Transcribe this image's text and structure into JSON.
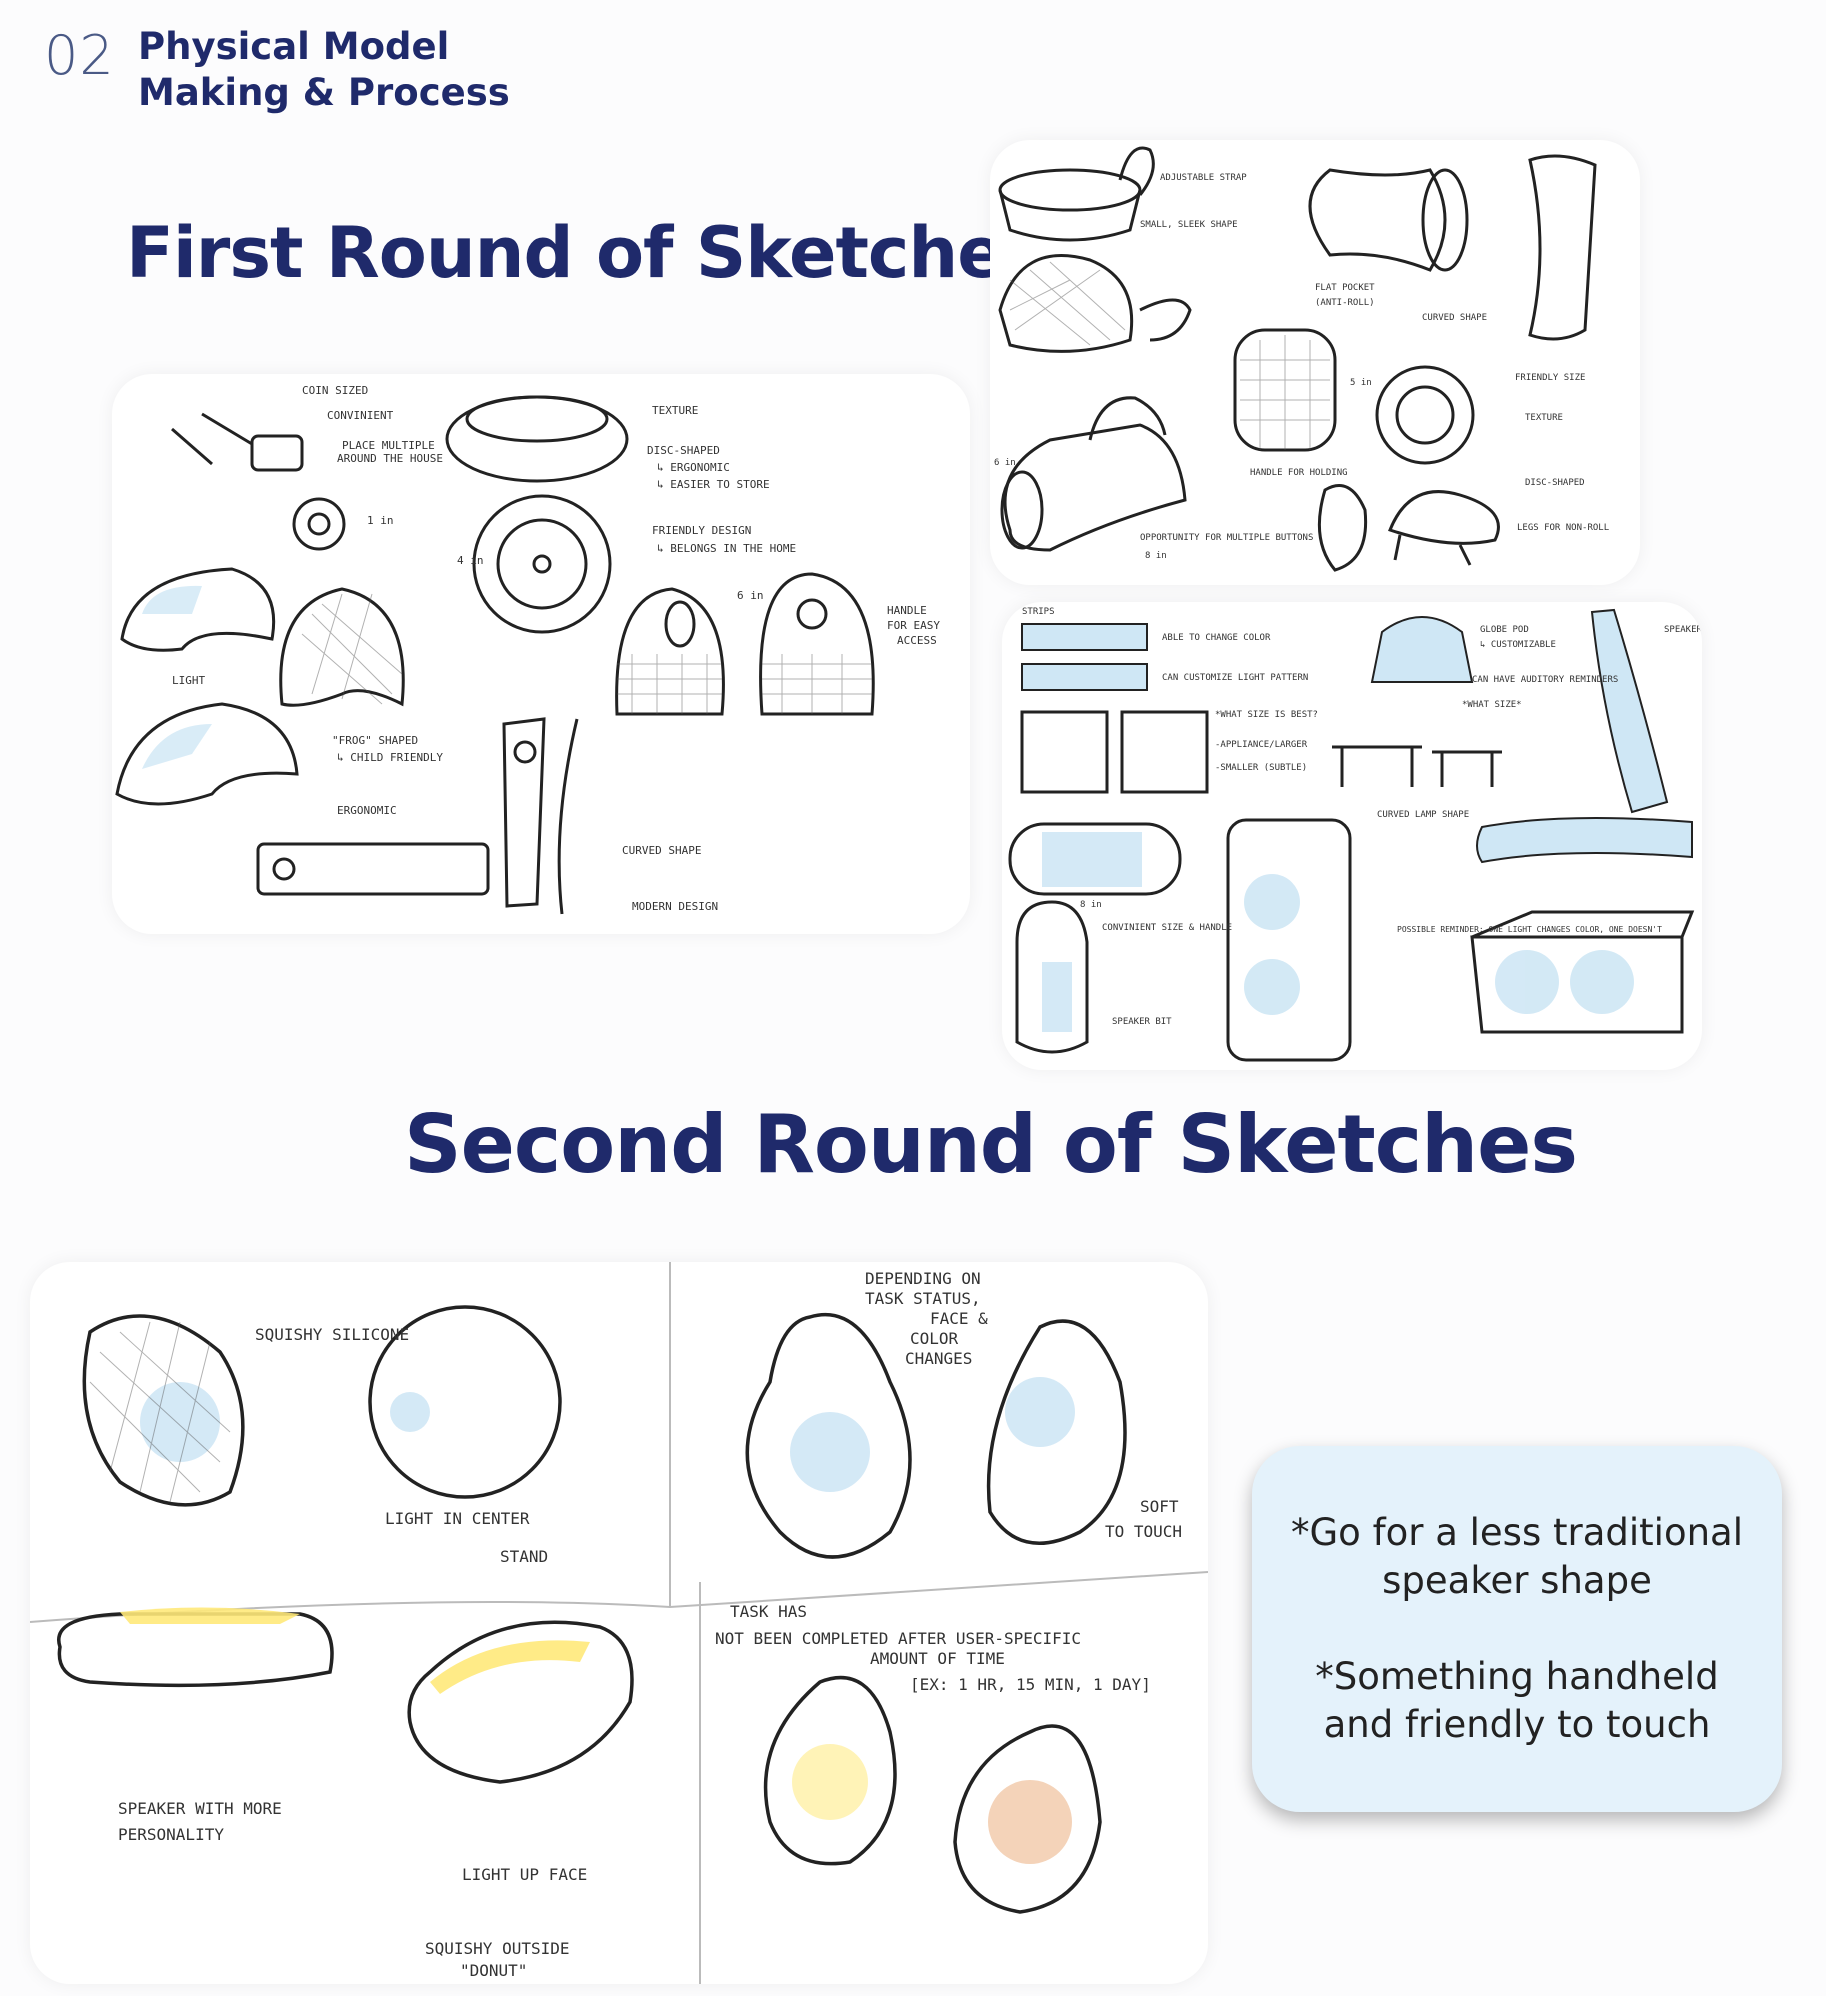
{
  "header": {
    "number": "02",
    "title_line1": "Physical Model",
    "title_line2": "Making & Process"
  },
  "headings": {
    "first_round": "First Round of Sketches",
    "second_round": "Second Round of Sketches"
  },
  "sketch_a": {
    "coin_sized": "COIN SIZED",
    "convinient": "CONVINIENT",
    "place_multiple": "PLACE MULTIPLE",
    "around_house": "AROUND THE HOUSE",
    "texture": "TEXTURE",
    "disc_shaped": "DISC-SHAPED",
    "ergonomic": "↳ ERGONOMIC",
    "easier_store": "↳ EASIER TO STORE",
    "friendly_design": "FRIENDLY DESIGN",
    "belongs_home": "↳ BELONGS IN THE HOME",
    "one_in": "1 in",
    "four_in": "4 in",
    "six_in": "6 in",
    "handle": "HANDLE",
    "for_easy": "FOR EASY",
    "access": "ACCESS",
    "light": "LIGHT",
    "frog_shaped": "\"FROG\" SHAPED",
    "child_friendly": "↳ CHILD FRIENDLY",
    "ergonomic2": "ERGONOMIC",
    "curved_shape": "CURVED SHAPE",
    "modern_design": "MODERN DESIGN"
  },
  "sketch_b": {
    "adjustable_strap": "ADJUSTABLE STRAP",
    "small_sleek": "SMALL, SLEEK SHAPE",
    "flat_pocket": "FLAT POCKET",
    "anti_roll": "(ANTI-ROLL)",
    "curved_shape": "CURVED SHAPE",
    "five_in": "5 in",
    "friendly_size": "FRIENDLY SIZE",
    "texture": "TEXTURE",
    "six_in": "6 in",
    "handle_holding": "HANDLE FOR HOLDING",
    "opportunity": "OPPORTUNITY FOR MULTIPLE BUTTONS",
    "eight_in": "8 in",
    "disc_shaped": "DISC-SHAPED",
    "legs": "LEGS FOR NON-ROLL"
  },
  "sketch_c": {
    "strips": "STRIPS",
    "able_change": "ABLE TO CHANGE COLOR",
    "customize_light": "CAN CUSTOMIZE LIGHT PATTERN",
    "globe_pod": "GLOBE POD",
    "customizable": "↳ CUSTOMIZABLE",
    "auditory": "CAN HAVE AUDITORY REMINDERS",
    "what_size": "*WHAT SIZE*",
    "what_size_best": "*WHAT SIZE IS BEST?",
    "appliance": "-APPLIANCE/LARGER",
    "smaller": "-SMALLER (SUBTLE)",
    "speaker": "SPEAKER",
    "curved_lamp": "CURVED LAMP SHAPE",
    "eight_in": "8 in",
    "convinient_size": "CONVINIENT SIZE & HANDLE",
    "speaker_bit": "SPEAKER BIT",
    "possible_reminder": "POSSIBLE REMINDER: ONE LIGHT CHANGES COLOR, ONE DOESN'T"
  },
  "sketch_d": {
    "squishy_silicone": "SQUISHY SILICONE",
    "light_center": "LIGHT IN CENTER",
    "stand": "STAND",
    "depending": "DEPENDING ON",
    "task_status": "TASK STATUS,",
    "face": "FACE &",
    "color": "COLOR",
    "changes": "CHANGES",
    "soft": "SOFT",
    "to_touch": "TO TOUCH",
    "task_has": "TASK HAS",
    "not_completed": "NOT BEEN COMPLETED AFTER USER-SPECIFIC",
    "amount_time": "AMOUNT OF TIME",
    "example": "[EX: 1 HR, 15 MIN, 1 DAY]",
    "speaker_more": "SPEAKER WITH MORE",
    "personality": "PERSONALITY",
    "light_face": "LIGHT UP FACE",
    "squishy_outside": "SQUISHY OUTSIDE",
    "donut": "\"DONUT\""
  },
  "note": {
    "line1": "*Go for a less traditional speaker shape",
    "line2": "*Something handheld and friendly to touch"
  }
}
